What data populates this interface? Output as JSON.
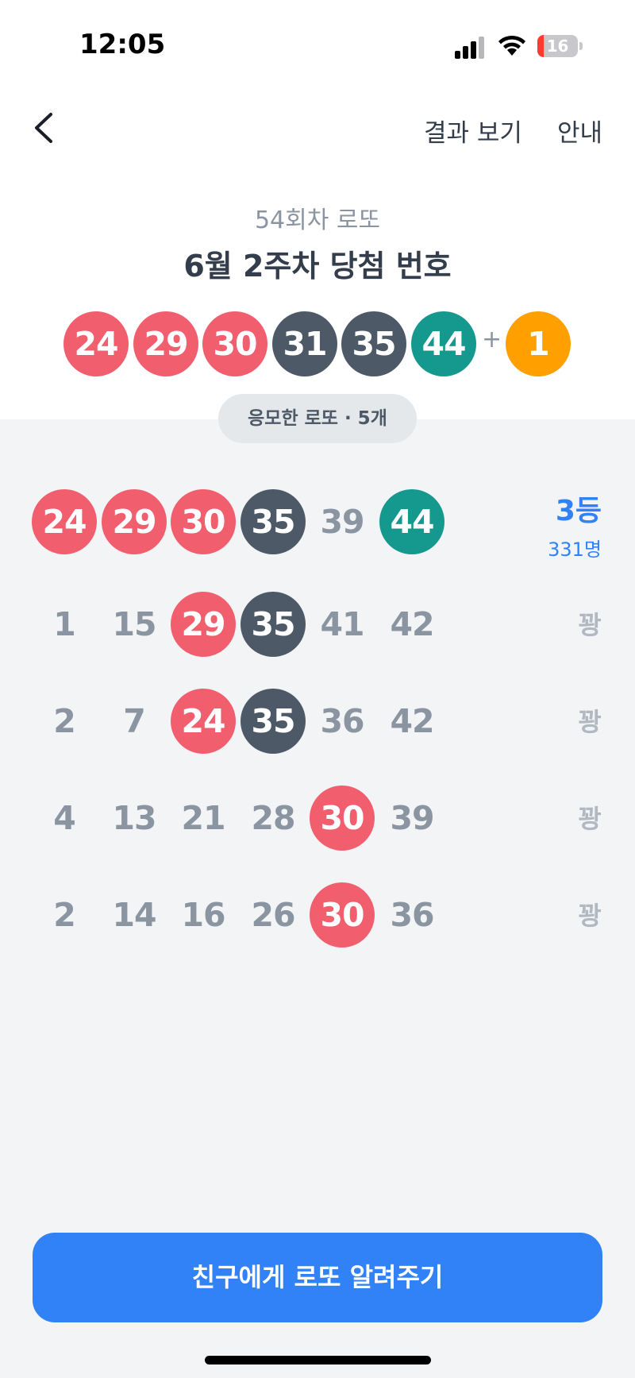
{
  "status_bar": {
    "time": "12:05",
    "battery_level": "16",
    "icons": [
      "signal-icon",
      "wifi-icon",
      "battery-icon"
    ]
  },
  "nav": {
    "back_icon": "chevron-left-icon",
    "results_label": "결과 보기",
    "info_label": "안내"
  },
  "draw": {
    "round_label": "54회차 로또",
    "title": "6월 2주차 당첨 번호",
    "numbers": [
      "24",
      "29",
      "30",
      "31",
      "35",
      "44"
    ],
    "plus": "+",
    "bonus": "1"
  },
  "entries_label": "응모한 로또 · 5개",
  "entries": [
    {
      "numbers": [
        "24",
        "29",
        "30",
        "35",
        "39",
        "44"
      ],
      "rank": "3등",
      "count": "331명"
    },
    {
      "numbers": [
        "1",
        "15",
        "29",
        "35",
        "41",
        "42"
      ],
      "result": "꽝"
    },
    {
      "numbers": [
        "2",
        "7",
        "24",
        "35",
        "36",
        "42"
      ],
      "result": "꽝"
    },
    {
      "numbers": [
        "4",
        "13",
        "21",
        "28",
        "30",
        "39"
      ],
      "result": "꽝"
    },
    {
      "numbers": [
        "2",
        "14",
        "16",
        "26",
        "30",
        "36"
      ],
      "result": "꽝"
    }
  ],
  "colors": {
    "red_ball": "#f15f6f",
    "dark_ball": "#4e5968",
    "teal_ball": "#15998f",
    "bonus_ball": "#ff9f00",
    "accent": "#3182f6",
    "background_gray": "#f2f4f6"
  },
  "share_button_label": "친구에게 로또 알려주기"
}
